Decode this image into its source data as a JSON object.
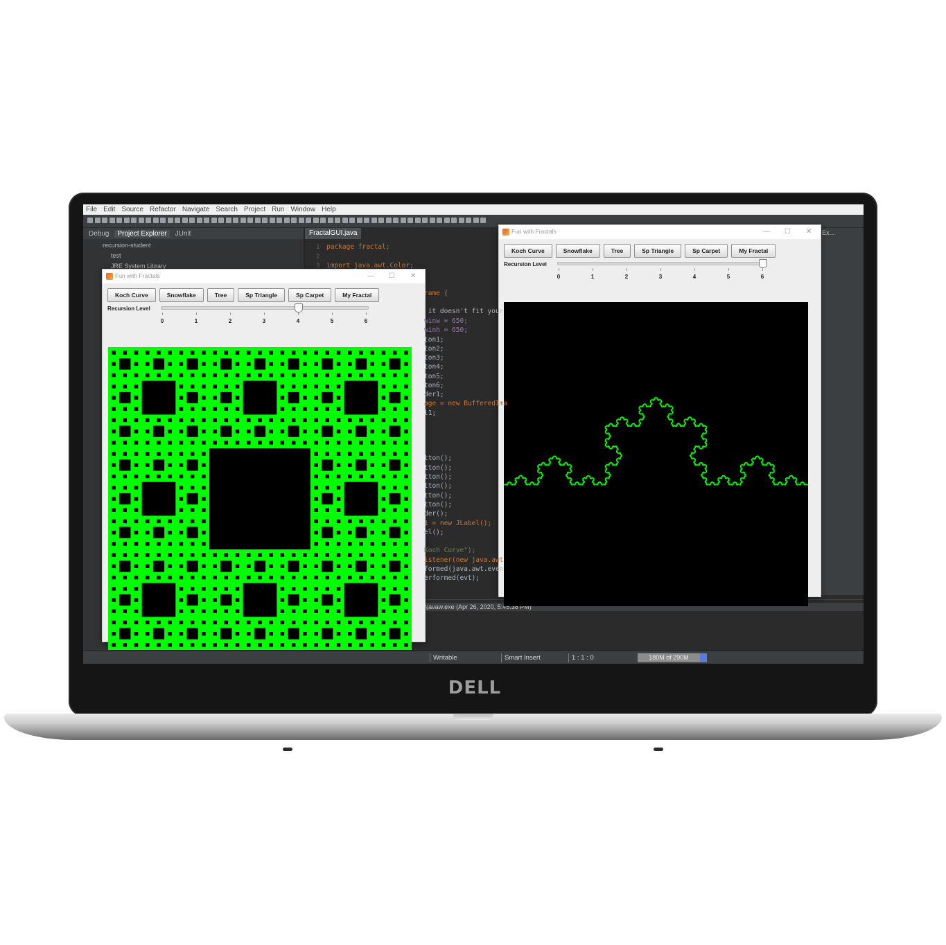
{
  "brand": "DELL",
  "eclipse": {
    "menu": [
      "File",
      "Edit",
      "Source",
      "Refactor",
      "Navigate",
      "Search",
      "Project",
      "Run",
      "Window",
      "Help"
    ],
    "left_tabs": [
      "Debug",
      "Project Explorer",
      "JUnit"
    ],
    "tree": [
      "recursion-student",
      "test",
      "JRE System Library"
    ],
    "editor_tab": "FractalGUI.java",
    "code_lines": [
      {
        "ln": "1",
        "text": "package fractal;"
      },
      {
        "ln": "2",
        "text": ""
      },
      {
        "ln": "3",
        "text": "import java.awt.Color;"
      }
    ],
    "code_fragments": [
      "rame {",
      " it doesn't fit your",
      "winw = 650;",
      "winh = 650;",
      "ton1;",
      "ton2;",
      "ton3;",
      "ton4;",
      "ton5;",
      "ton6;",
      "der1;",
      "age = new BufferedIma",
      "l1;",
      "tton();",
      "tton();",
      "tton();",
      "tton();",
      "tton();",
      "tton();",
      "der();",
      "1 = new JLabel();",
      "el();",
      "Koch Curve\");",
      "istener(new java.awt",
      "formed(java.awt.even",
      "erformed(evt);"
    ],
    "console_text": "es\\AdoptOpenJDK\\jdk-12.0.2.10-openj9\\bin\\javaw.exe (Apr 26, 2020, 5:45:38 PM)",
    "status": {
      "writable": "Writable",
      "insert_mode": "Smart Insert",
      "position": "1 : 1 : 0",
      "memory": "180M of 290M"
    },
    "right_tab": "Ex..."
  },
  "windows": [
    {
      "title": "Fun with Fractals",
      "buttons": [
        "Koch Curve",
        "Snowflake",
        "Tree",
        "Sp Triangle",
        "Sp Carpet",
        "My Fractal"
      ],
      "slider_label": "Recursion Level",
      "ticks": [
        "0",
        "1",
        "2",
        "3",
        "4",
        "5",
        "6"
      ],
      "slider_value": 4,
      "fractal": "Sp Carpet",
      "fill_color": "#00ff00",
      "background": "#000000"
    },
    {
      "title": "Fun with Fractals",
      "buttons": [
        "Koch Curve",
        "Snowflake",
        "Tree",
        "Sp Triangle",
        "Sp Carpet",
        "My Fractal"
      ],
      "slider_label": "Recursion Level",
      "ticks": [
        "0",
        "1",
        "2",
        "3",
        "4",
        "5",
        "6"
      ],
      "slider_value": 6,
      "fractal": "Koch Curve",
      "stroke_color": "#00ff00",
      "background": "#000000"
    }
  ]
}
